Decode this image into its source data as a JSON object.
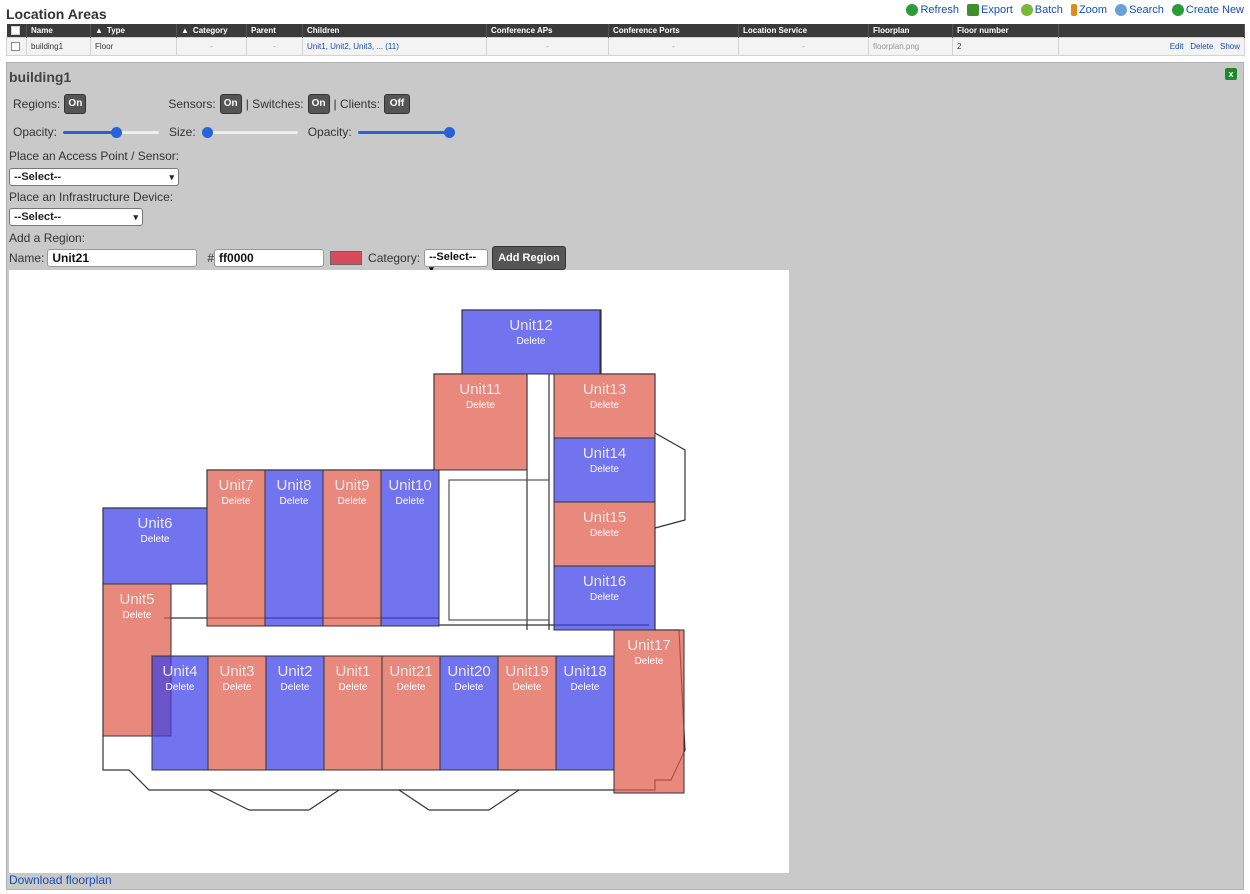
{
  "header": {
    "title": "Location Areas",
    "actions": [
      {
        "label": "Refresh",
        "icon": "refresh-icon",
        "color": "#2a9a3a"
      },
      {
        "label": "Export",
        "icon": "export-icon",
        "color": "#3f8f2f"
      },
      {
        "label": "Batch",
        "icon": "batch-icon",
        "color": "#7ab53d"
      },
      {
        "label": "Zoom",
        "icon": "zoom-icon",
        "color": "#e08a1e"
      },
      {
        "label": "Search",
        "icon": "search-icon",
        "color": "#6aa0d8"
      },
      {
        "label": "Create New",
        "icon": "create-icon",
        "color": "#2a9a3a"
      }
    ]
  },
  "table": {
    "columns": [
      "Name",
      "Type",
      "Category",
      "Parent",
      "Children",
      "Conference APs",
      "Conference Ports",
      "Location Service",
      "Floorplan",
      "Floor number"
    ],
    "row": {
      "name": "building1",
      "type": "Floor",
      "category": "-",
      "parent": "-",
      "children": "Unit1, Unit2, Unit3, ... (11)",
      "conf_aps": "-",
      "conf_ports": "-",
      "location_service": "-",
      "floorplan": "floorplan.png",
      "floor_number": "2",
      "actions": [
        "Edit",
        "Delete",
        "Show"
      ]
    }
  },
  "detail": {
    "title": "building1",
    "regions_label": "Regions:",
    "regions_state": "On",
    "sensors_label": "Sensors:",
    "sensors_state": "On",
    "switches_label": "| Switches:",
    "switches_state": "On",
    "clients_label": "| Clients:",
    "clients_state": "Off",
    "opacity_label": "Opacity:",
    "size_label": "Size:",
    "opacity1": 0.55,
    "size": 0.05,
    "opacity2": 0.95,
    "place_ap_label": "Place an Access Point / Sensor:",
    "place_ap_value": "--Select--",
    "place_infra_label": "Place an Infrastructure Device:",
    "place_infra_value": "--Select--",
    "add_region_label": "Add a Region:",
    "name_label": "Name:",
    "name_value": "Unit21",
    "hash": "#",
    "color_value": "ff0000",
    "category_label": "Category:",
    "category_value": "--Select--",
    "add_region_button": "Add Region",
    "delete_label": "Delete",
    "download_label": "Download floorplan",
    "colors": {
      "red": "#e05a4a",
      "blue": "#3a3ee8"
    },
    "units": [
      {
        "name": "Unit12",
        "color": "blue"
      },
      {
        "name": "Unit11",
        "color": "red"
      },
      {
        "name": "Unit13",
        "color": "red"
      },
      {
        "name": "Unit14",
        "color": "blue"
      },
      {
        "name": "Unit15",
        "color": "red"
      },
      {
        "name": "Unit16",
        "color": "blue"
      },
      {
        "name": "Unit7",
        "color": "red"
      },
      {
        "name": "Unit8",
        "color": "blue"
      },
      {
        "name": "Unit9",
        "color": "red"
      },
      {
        "name": "Unit10",
        "color": "blue"
      },
      {
        "name": "Unit6",
        "color": "blue"
      },
      {
        "name": "Unit5",
        "color": "red"
      },
      {
        "name": "Unit4",
        "color": "blue"
      },
      {
        "name": "Unit3",
        "color": "red"
      },
      {
        "name": "Unit2",
        "color": "blue"
      },
      {
        "name": "Unit1",
        "color": "red"
      },
      {
        "name": "Unit21",
        "color": "red"
      },
      {
        "name": "Unit20",
        "color": "blue"
      },
      {
        "name": "Unit19",
        "color": "red"
      },
      {
        "name": "Unit18",
        "color": "blue"
      },
      {
        "name": "Unit17",
        "color": "red"
      }
    ]
  }
}
